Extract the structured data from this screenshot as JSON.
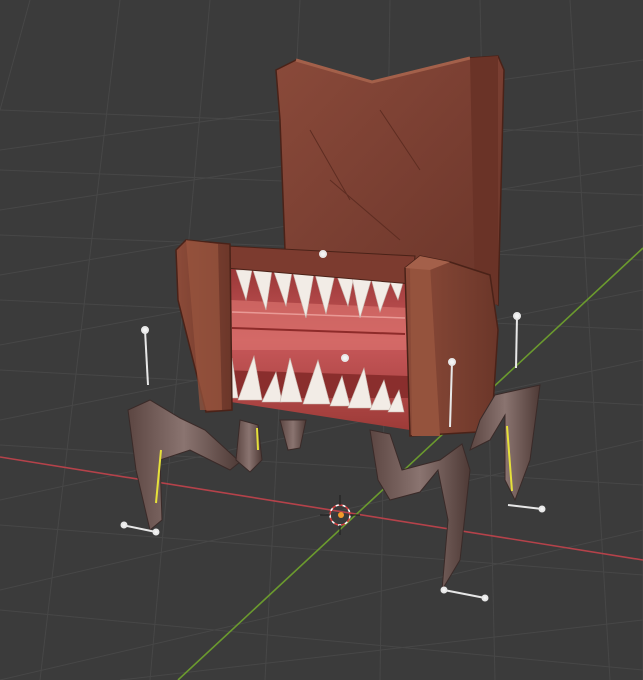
{
  "viewport": {
    "background_color": "#3b3b3b",
    "grid_color": "#454545",
    "x_axis_color": "#b5424a",
    "y_axis_color": "#6b9a2e"
  },
  "scene": {
    "object": "mimic-armchair",
    "chair_color": "#7a3f32",
    "mouth_color": "#b84a48",
    "tooth_color": "#f2ece6",
    "leg_color": "#6b5550",
    "bone_highlight_color": "#e6e13a",
    "bone_handle_color": "#e8e8e8"
  },
  "icons": {
    "origin": "3d-cursor-icon"
  }
}
